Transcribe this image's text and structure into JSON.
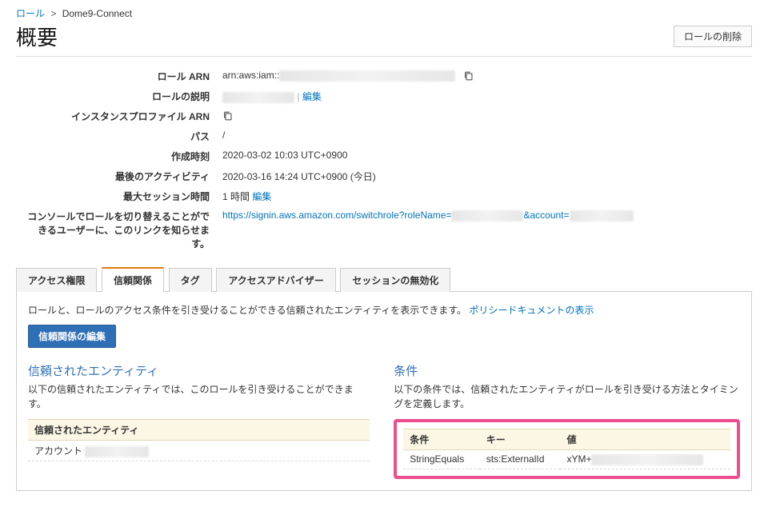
{
  "breadcrumb": {
    "parent": "ロール",
    "current": "Dome9-Connect"
  },
  "header": {
    "title": "概要",
    "delete_btn": "ロールの削除"
  },
  "details": {
    "arn_label": "ロール ARN",
    "arn_value": "arn:aws:iam::",
    "desc_label": "ロールの説明",
    "desc_edit": "編集",
    "profile_label": "インスタンスプロファイル ARN",
    "path_label": "パス",
    "path_value": "/",
    "created_label": "作成時刻",
    "created_value": "2020-03-02 10:03 UTC+0900",
    "activity_label": "最後のアクティビティ",
    "activity_value": "2020-03-16 14:24 UTC+0900 (今日)",
    "session_label": "最大セッション時間",
    "session_value": "1 時間",
    "session_edit": "編集",
    "switch_label": "コンソールでロールを切り替えることができるユーザーに、このリンクを知らせます。",
    "switch_url": "https://signin.aws.amazon.com/switchrole?roleName=",
    "switch_account": "&account="
  },
  "tabs": {
    "perm": "アクセス権限",
    "trust": "信頼関係",
    "tags": "タグ",
    "advisor": "アクセスアドバイザー",
    "revoke": "セッションの無効化"
  },
  "trust": {
    "desc": "ロールと、ロールのアクセス条件を引き受けることができる信頼されたエンティティを表示できます。",
    "policy_link": "ポリシードキュメントの表示",
    "edit_btn": "信頼関係の編集",
    "entities_title": "信頼されたエンティティ",
    "entities_desc": "以下の信頼されたエンティティでは、このロールを引き受けることができます。",
    "entities_header": "信頼されたエンティティ",
    "entities_account": "アカウント",
    "cond_title": "条件",
    "cond_desc": "以下の条件では、信頼されたエンティティがロールを引き受ける方法とタイミングを定義します。",
    "cond_h1": "条件",
    "cond_h2": "キー",
    "cond_h3": "値",
    "cond_v1": "StringEquals",
    "cond_v2": "sts:ExternalId",
    "cond_v3": "xYM+"
  }
}
